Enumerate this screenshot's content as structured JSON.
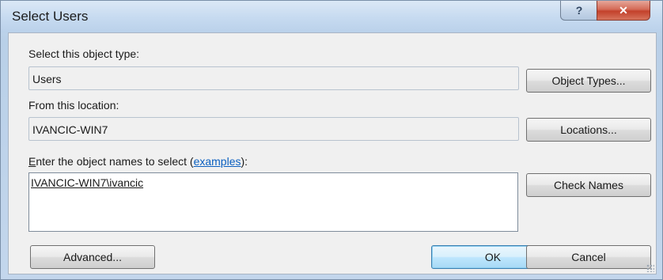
{
  "window": {
    "title": "Select Users"
  },
  "titlebar": {
    "help_glyph": "?",
    "close_glyph": "✕"
  },
  "object_type": {
    "label": "Select this object type:",
    "value": "Users",
    "button": "Object Types..."
  },
  "location": {
    "label": "From this location:",
    "value": "IVANCIC-WIN7",
    "button": "Locations..."
  },
  "names": {
    "label_prefix": "Enter the object names to select (",
    "label_prefix_first": "E",
    "label_prefix_rest": "nter the object names to select (",
    "examples_link": "examples",
    "label_suffix": "):",
    "value": "IVANCIC-WIN7\\ivancic",
    "check_button": "Check Names"
  },
  "footer": {
    "advanced_button": "Advanced...",
    "ok_button": "OK",
    "cancel_button": "Cancel"
  },
  "colors": {
    "title_bar": "#c6daf0",
    "close_button": "#c3412b",
    "dialog_bg": "#f0f0f0",
    "link": "#0a5fc0",
    "default_button_border": "#3c7fb1"
  }
}
